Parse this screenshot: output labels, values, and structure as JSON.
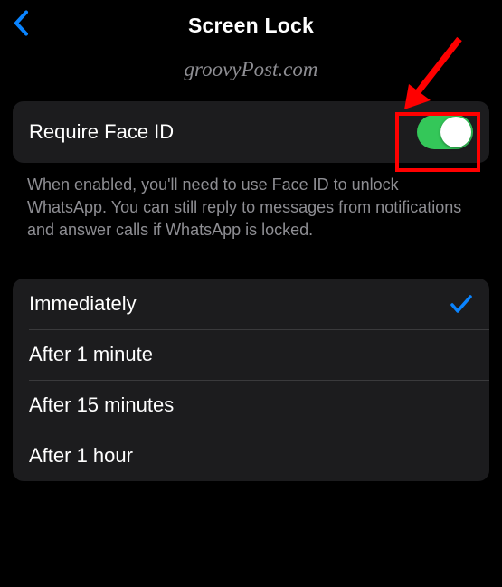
{
  "header": {
    "title": "Screen Lock"
  },
  "watermark": "groovyPost.com",
  "face_id": {
    "label": "Require Face ID",
    "enabled": true,
    "description": "When enabled, you'll need to use Face ID to unlock WhatsApp. You can still reply to messages from notifications and answer calls if WhatsApp is locked."
  },
  "timing_options": [
    {
      "label": "Immediately",
      "selected": true
    },
    {
      "label": "After 1 minute",
      "selected": false
    },
    {
      "label": "After 15 minutes",
      "selected": false
    },
    {
      "label": "After 1 hour",
      "selected": false
    }
  ],
  "colors": {
    "accent_blue": "#0a84ff",
    "toggle_green": "#34c759",
    "annotation_red": "#ff0000"
  }
}
